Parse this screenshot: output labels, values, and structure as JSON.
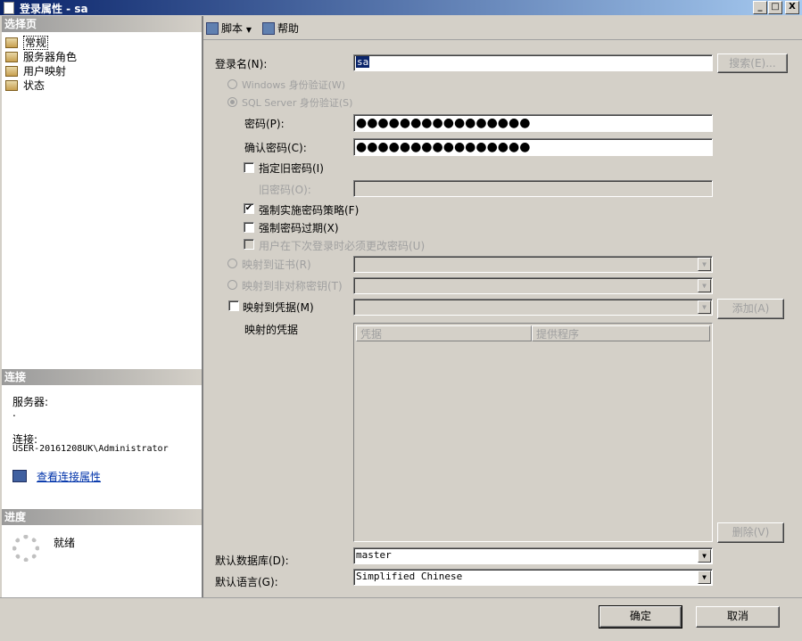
{
  "window": {
    "title": "登录属性 - sa",
    "minimize": "_",
    "maximize": "□",
    "close": "X"
  },
  "left_panel": {
    "select_page_header": "选择页",
    "pages": [
      "常规",
      "服务器角色",
      "用户映射",
      "状态"
    ],
    "connection_header": "连接",
    "server_label": "服务器:",
    "server_value": ".",
    "connection_label": "连接:",
    "connection_value": "USER-20161208UK\\Administrator",
    "view_connection_props": "查看连接属性",
    "progress_header": "进度",
    "progress_status": "就绪"
  },
  "toolbar": {
    "script": "脚本",
    "help": "帮助"
  },
  "form": {
    "login_name_label": "登录名(N):",
    "login_name_value": "sa",
    "search_button": "搜索(E)...",
    "windows_auth": "Windows 身份验证(W)",
    "sql_auth": "SQL Server 身份验证(S)",
    "password_label": "密码(P):",
    "password_value": "●●●●●●●●●●●●●●●●",
    "confirm_label": "确认密码(C):",
    "confirm_value": "●●●●●●●●●●●●●●●●",
    "specify_old": "指定旧密码(I)",
    "old_password_label": "旧密码(O):",
    "enforce_policy": "强制实施密码策略(F)",
    "enforce_expiration": "强制密码过期(X)",
    "must_change": "用户在下次登录时必须更改密码(U)",
    "map_cert": "映射到证书(R)",
    "map_asym": "映射到非对称密钥(T)",
    "map_credential": "映射到凭据(M)",
    "add_button": "添加(A)",
    "mapped_credentials_label": "映射的凭据",
    "col_credential": "凭据",
    "col_provider": "提供程序",
    "remove_button": "删除(V)",
    "default_db_label": "默认数据库(D):",
    "default_db_value": "master",
    "default_lang_label": "默认语言(G):",
    "default_lang_value": "Simplified Chinese"
  },
  "footer": {
    "ok": "确定",
    "cancel": "取消"
  }
}
